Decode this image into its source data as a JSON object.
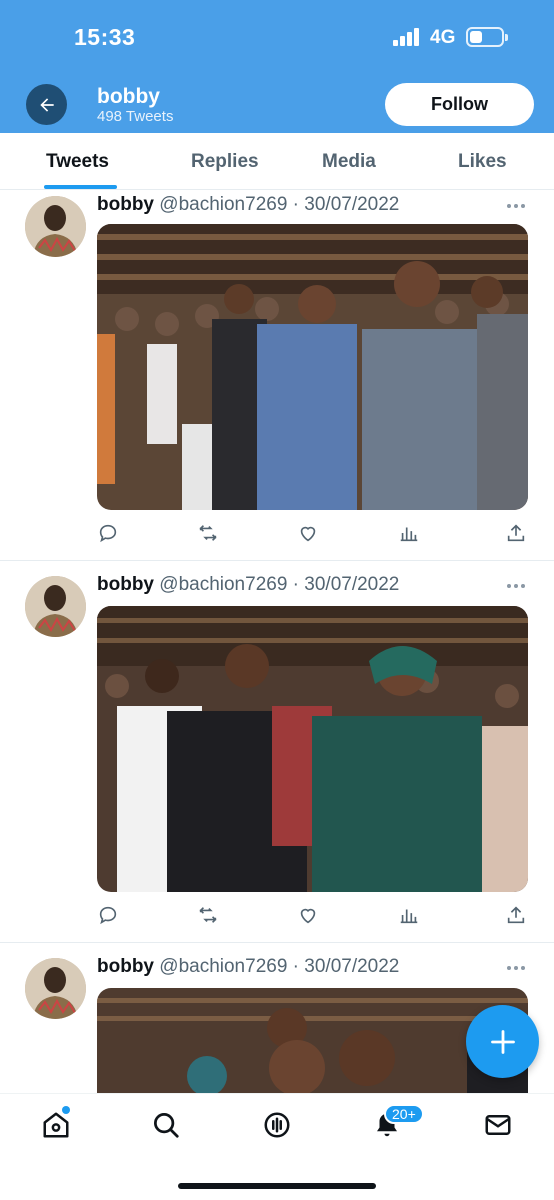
{
  "status_bar": {
    "time": "15:33",
    "network": "4G"
  },
  "header": {
    "name": "bobby",
    "tweet_count": "498 Tweets",
    "follow_label": "Follow"
  },
  "tabs": [
    {
      "label": "Tweets",
      "active": true
    },
    {
      "label": "Replies",
      "active": false
    },
    {
      "label": "Media",
      "active": false
    },
    {
      "label": "Likes",
      "active": false
    }
  ],
  "tweets": [
    {
      "name": "bobby",
      "meta": "@bachion7269 · 30/07/2022",
      "media": "photo-crowd-praying"
    },
    {
      "name": "bobby",
      "meta": "@bachion7269 · 30/07/2022",
      "media": "photo-couple-greeting"
    },
    {
      "name": "bobby",
      "meta": "@bachion7269 · 30/07/2022",
      "media": "photo-group-event"
    }
  ],
  "actions": [
    "reply-icon",
    "retweet-icon",
    "like-icon",
    "analytics-icon",
    "share-icon"
  ],
  "notifications_badge": "20+",
  "colors": {
    "header_bg": "#4a9fe8",
    "accent": "#1d9bf0",
    "back_button": "#1f4e74"
  }
}
